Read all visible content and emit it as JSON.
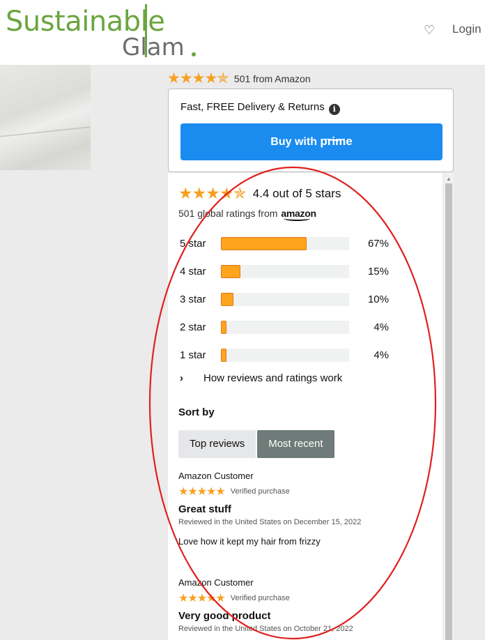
{
  "brand": {
    "logo_top": "Sustainable",
    "logo_bottom": "Glam",
    "color_primary": "#6aa53f",
    "color_secondary": "#6d6d6d"
  },
  "header": {
    "wishlist_icon": "heart-icon",
    "login_label": "Login"
  },
  "summary": {
    "stars": "★★★★✯",
    "count_text": "501 from Amazon"
  },
  "delivery": {
    "text": "Fast, FREE Delivery & Returns",
    "info_icon": "i",
    "buy_prefix": "Buy with ",
    "buy_prime": "prime"
  },
  "ratings": {
    "average_stars": "★★★★✯",
    "average_text": "4.4 out of 5 stars",
    "global_text": "501 global ratings from",
    "amazon_word": "amazon",
    "histogram": [
      {
        "label": "5 star",
        "percent": 67,
        "percent_text": "67%"
      },
      {
        "label": "4 star",
        "percent": 15,
        "percent_text": "15%"
      },
      {
        "label": "3 star",
        "percent": 10,
        "percent_text": "10%"
      },
      {
        "label": "2 star",
        "percent": 4,
        "percent_text": "4%"
      },
      {
        "label": "1 star",
        "percent": 4,
        "percent_text": "4%"
      }
    ],
    "how_chevron": "›",
    "how_text": "How reviews and ratings work"
  },
  "sort": {
    "label": "Sort by",
    "options": [
      "Top reviews",
      "Most recent"
    ],
    "selected": "Most recent"
  },
  "reviews": [
    {
      "author": "Amazon Customer",
      "stars": "★★★★★",
      "verified": "Verified purchase",
      "title": "Great stuff",
      "date": "Reviewed in the United States on December 15, 2022",
      "body": "Love how it kept my hair from frizzy"
    },
    {
      "author": "Amazon Customer",
      "stars": "★★★★★",
      "verified": "Verified purchase",
      "title": "Very good product",
      "date": "Reviewed in the United States on October 21, 2022",
      "body": ""
    }
  ],
  "colors": {
    "star": "#f7a020",
    "bar_fill": "#ffa41c",
    "prime_button": "#1a8cf0",
    "annotation_ellipse": "#e02020"
  }
}
